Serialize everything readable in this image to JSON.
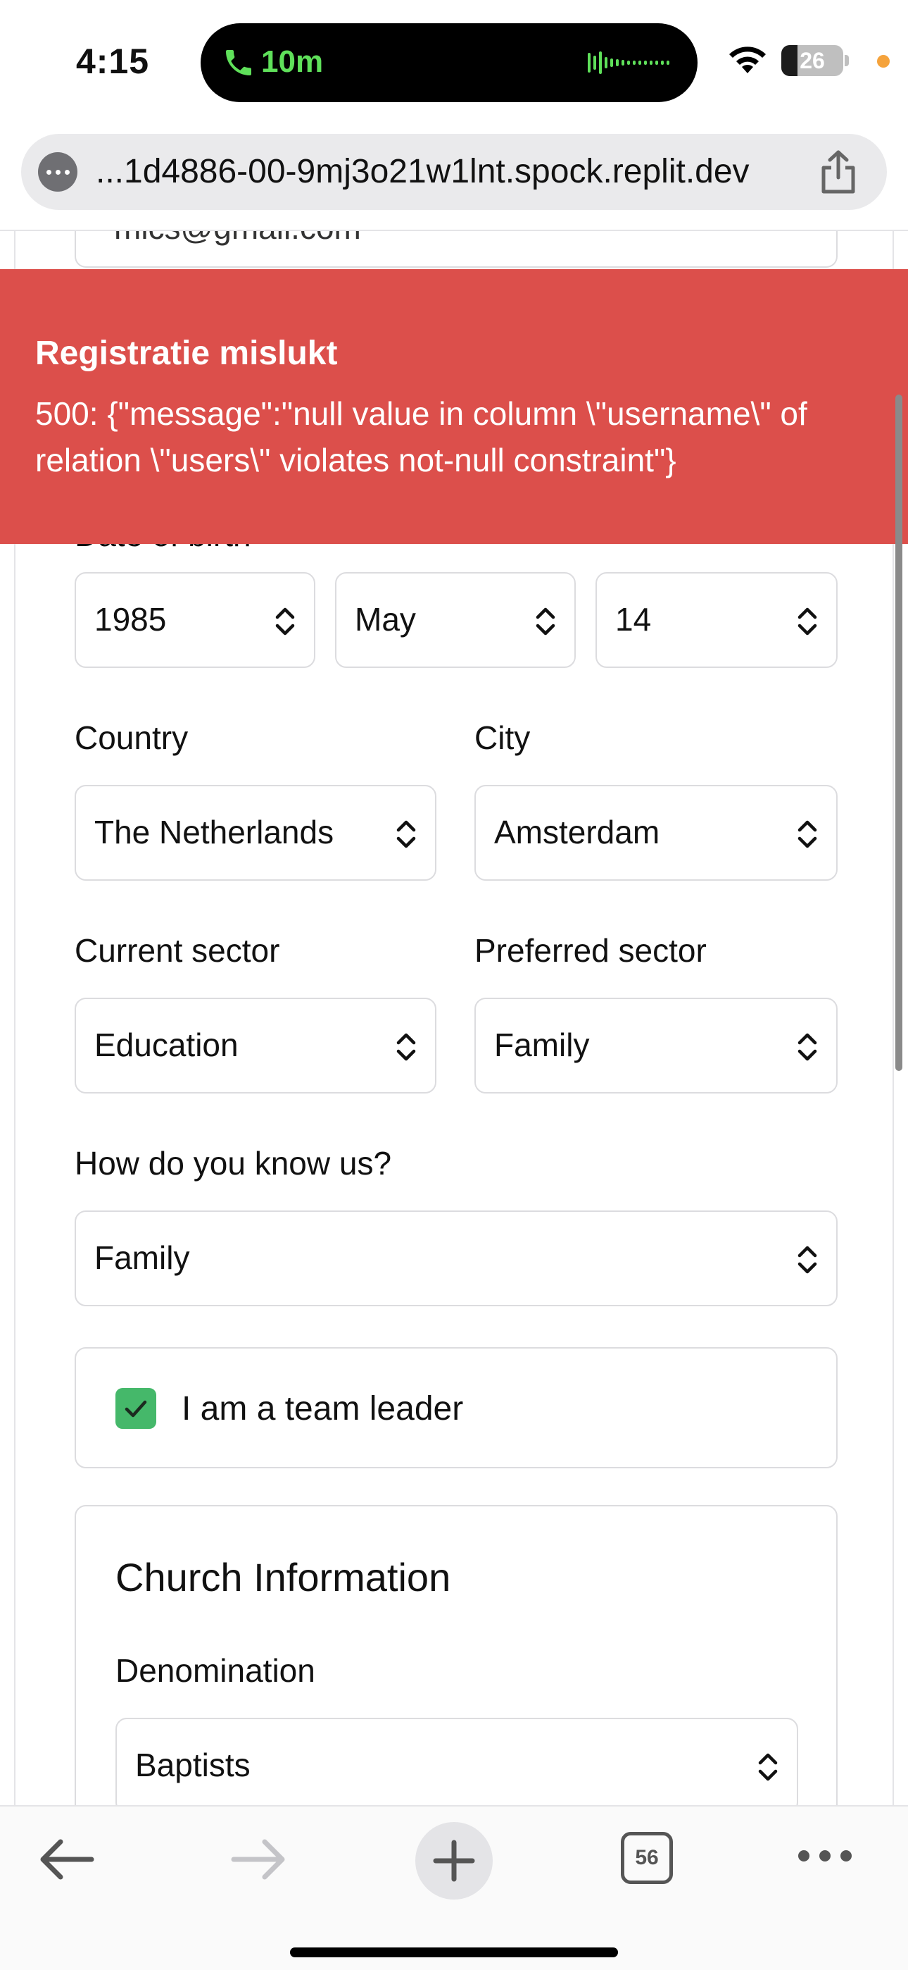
{
  "status_bar": {
    "time": "4:15",
    "call_duration": "10m",
    "battery_level": "26",
    "battery_fraction": 0.26,
    "icons": [
      "phone-icon",
      "waveform-icon",
      "wifi-icon",
      "battery-icon"
    ]
  },
  "browser": {
    "url": "...1d4886-00-9mj3o21w1lnt.spock.replit.dev",
    "tab_count": "56"
  },
  "form": {
    "email_value": "mics@gmail.com",
    "date_of_birth_label": "Date of birth",
    "dob_year": "1985",
    "dob_month": "May",
    "dob_day": "14",
    "country_label": "Country",
    "country_value": "The Netherlands",
    "city_label": "City",
    "city_value": "Amsterdam",
    "current_sector_label": "Current sector",
    "current_sector_value": "Education",
    "preferred_sector_label": "Preferred sector",
    "preferred_sector_value": "Family",
    "how_know_label": "How do you know us?",
    "how_know_value": "Family",
    "team_leader_label": "I am a team leader",
    "team_leader_checked": true
  },
  "church": {
    "title": "Church Information",
    "denomination_label": "Denomination",
    "denomination_value": "Baptists"
  },
  "toast": {
    "title": "Registratie mislukt",
    "message": "500: {\"message\":\"null value in column \\\"username\\\" of relation \\\"users\\\" violates not-null constraint\"}"
  },
  "colors": {
    "toast_bg": "#dc4f4b",
    "checkbox_green": "#45b86a",
    "call_green": "#5fe05a"
  }
}
